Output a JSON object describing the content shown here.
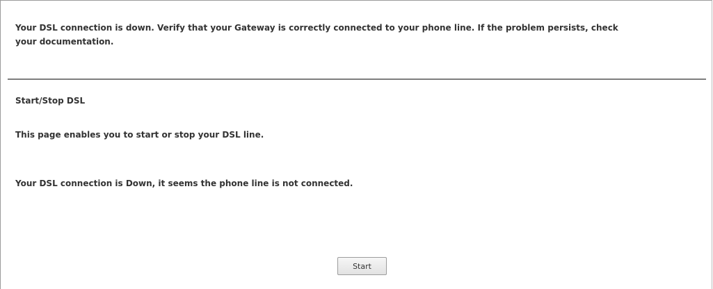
{
  "alert": {
    "message": "Your DSL connection is down. Verify that your Gateway is correctly connected to your phone line. If the problem persists, check your documentation."
  },
  "section": {
    "title": "Start/Stop DSL",
    "description": "This page enables you to start or stop your DSL line.",
    "status": "Your DSL connection is Down, it seems the phone line is not connected."
  },
  "actions": {
    "start_label": "Start"
  }
}
